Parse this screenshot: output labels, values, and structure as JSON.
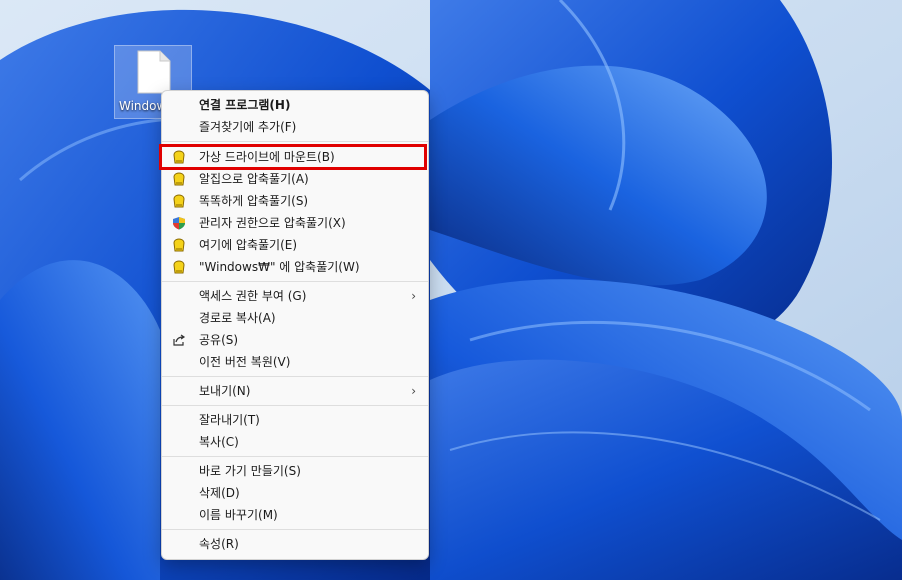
{
  "desktop": {
    "icon_label": "Window",
    "colors": {
      "wallpaper_dark": "#0a2f8a",
      "wallpaper_light": "#cfe0f2",
      "highlight": "#e00000"
    }
  },
  "context_menu": {
    "groups": [
      [
        {
          "label": "연결 프로그램(H)",
          "icon": "none",
          "bold": true
        },
        {
          "label": "즐겨찾기에 추가(F)",
          "icon": "none"
        }
      ],
      [
        {
          "label": "가상 드라이브에 마운트(B)",
          "icon": "bandizip-icon",
          "highlighted": true
        },
        {
          "label": "알집으로 압축풀기(A)",
          "icon": "bandizip-icon"
        },
        {
          "label": "똑똑하게 압축풀기(S)",
          "icon": "bandizip-icon"
        },
        {
          "label": "관리자 권한으로 압축풀기(X)",
          "icon": "shield-icon"
        },
        {
          "label": "여기에 압축풀기(E)",
          "icon": "bandizip-icon"
        },
        {
          "label": "\"Windows₩\" 에 압축풀기(W)",
          "icon": "bandizip-icon"
        }
      ],
      [
        {
          "label": "액세스 권한 부여 (G)",
          "icon": "none",
          "submenu": true
        },
        {
          "label": "경로로 복사(A)",
          "icon": "none"
        },
        {
          "label": "공유(S)",
          "icon": "share-icon"
        },
        {
          "label": "이전 버전 복원(V)",
          "icon": "none"
        }
      ],
      [
        {
          "label": "보내기(N)",
          "icon": "none",
          "submenu": true
        }
      ],
      [
        {
          "label": "잘라내기(T)",
          "icon": "none"
        },
        {
          "label": "복사(C)",
          "icon": "none"
        }
      ],
      [
        {
          "label": "바로 가기 만들기(S)",
          "icon": "none"
        },
        {
          "label": "삭제(D)",
          "icon": "none"
        },
        {
          "label": "이름 바꾸기(M)",
          "icon": "none"
        }
      ],
      [
        {
          "label": "속성(R)",
          "icon": "none"
        }
      ]
    ],
    "submenu_glyph": "›"
  }
}
